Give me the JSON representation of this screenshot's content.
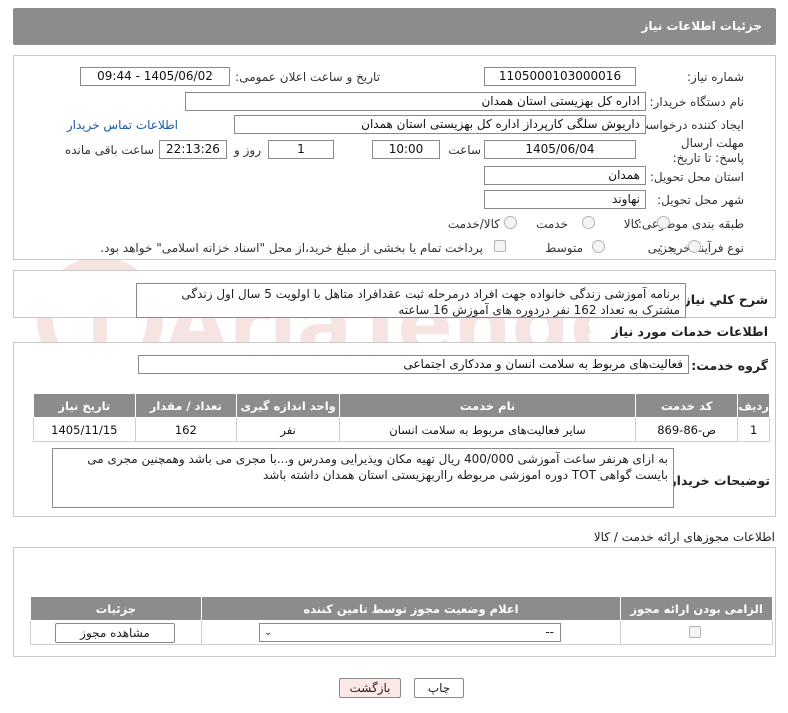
{
  "header": {
    "title": "جزئیات اطلاعات نیاز"
  },
  "fields": {
    "need_number_label": "شماره نیاز:",
    "need_number": "1105000103000016",
    "announce_label": "تاریخ و ساعت اعلان عمومی:",
    "announce_value": "1405/06/02 - 09:44",
    "buyer_org_label": "نام دستگاه خریدار:",
    "buyer_org": "اداره کل بهزیستی استان همدان",
    "requester_label": "ایجاد کننده درخواست:",
    "requester": "داریوش سلگی کارپرداز اداره کل بهزیستی استان همدان",
    "contact_link": "اطلاعات تماس خریدار",
    "deadline_label": "مهلت ارسال پاسخ: تا تاریخ:",
    "deadline_date": "1405/06/04",
    "time_label": "ساعت",
    "deadline_time": "10:00",
    "days_value": "1",
    "days_label": "روز و",
    "remaining_time": "22:13:26",
    "remaining_label": "ساعت باقی مانده",
    "province_label": "استان محل تحویل:",
    "province": "همدان",
    "city_label": "شهر محل تحویل:",
    "city": "نهاوند",
    "category_label": "طبقه بندی موضوعی:",
    "category_options": [
      "کالا",
      "خدمت",
      "کالا/خدمت"
    ],
    "purchase_type_label": "نوع فرآیند خرید :",
    "purchase_options": [
      "جزیی",
      "متوسط"
    ],
    "treasury_text": "پرداخت تمام یا بخشی از مبلغ خرید،از محل \"اسناد خزانه اسلامی\" خواهد بود."
  },
  "description": {
    "label": "شرح کلي نياز:",
    "text": "برنامه آموزشی زندگی خانواده جهت افراد درمرحله ثبت عقدافراد متاهل با اولویت 5 سال اول زندگی مشترک به تعداد 162 نفر دردوره های آموزش 16 ساعته"
  },
  "services": {
    "section_title": "اطلاعات خدمات مورد نیاز",
    "group_label": "گروه خدمت:",
    "group_value": "فعالیت‌های مربوط به سلامت انسان و مددکاری اجتماعی",
    "columns": [
      "ردیف",
      "کد خدمت",
      "نام خدمت",
      "واحد اندازه گیری",
      "تعداد / مقدار",
      "تاریخ نیاز"
    ],
    "rows": [
      {
        "row": "1",
        "code": "ص-86-869",
        "name": "سایر فعالیت‌های مربوط به سلامت انسان",
        "unit": "نفر",
        "qty": "162",
        "date": "1405/11/15"
      }
    ]
  },
  "buyer_notes": {
    "label": "توضیحات خریدار:",
    "text": "به ازای هرنفر ساعت آموزشی 400/000 ریال تهیه مکان ویذیرایی ومدرس و...با مجری می باشد وهمچنین مجری می بایست گواهی TOT دوره اموزشی مربوطه رااربهزیستی استان همدان داشته باشد"
  },
  "licenses": {
    "section_title": "اطلاعات مجوزهای ارائه خدمت / کالا",
    "columns": [
      "الزامی بودن ارائه مجوز",
      "اعلام وضعیت مجوز توسط تامین کننده",
      "جزئیات"
    ],
    "select_value": "--",
    "view_button": "مشاهده مجوز"
  },
  "buttons": {
    "print": "چاپ",
    "back": "بازگشت"
  },
  "watermark": "AriaTender.net",
  "colors": {
    "header_bg": "#8c8c8c",
    "link": "#1a5aa8",
    "back_btn_bg": "#fde8e8"
  }
}
